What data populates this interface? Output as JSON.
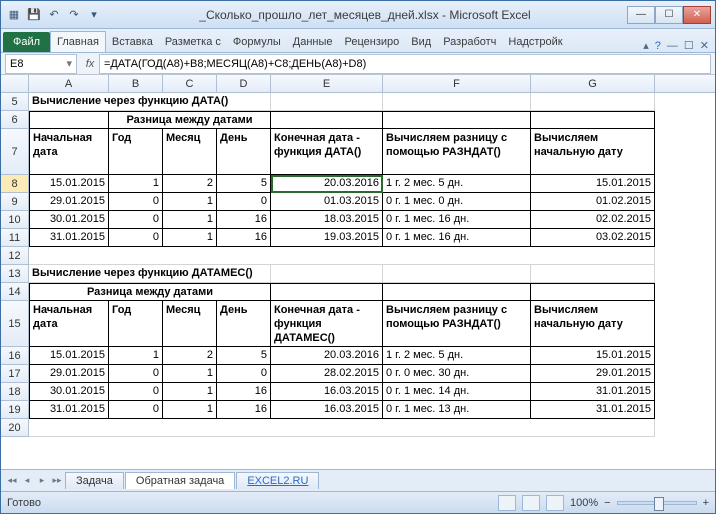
{
  "title": "_Сколько_прошло_лет_месяцев_дней.xlsx - Microsoft Excel",
  "ribbon": {
    "file": "Файл",
    "tabs": [
      "Главная",
      "Вставка",
      "Разметка с",
      "Формулы",
      "Данные",
      "Рецензиро",
      "Вид",
      "Разработч",
      "Надстройк"
    ]
  },
  "name_box": "E8",
  "formula": "=ДАТА(ГОД(A8)+B8;МЕСЯЦ(A8)+C8;ДЕНЬ(A8)+D8)",
  "cols": [
    "A",
    "B",
    "C",
    "D",
    "E",
    "F",
    "G"
  ],
  "row5_title": "Вычисление через функцию ДАТА()",
  "row6_merge": "Разница между датами",
  "row7": {
    "a": "Начальная дата",
    "b": "Год",
    "c": "Месяц",
    "d": "День",
    "e": "Конечная дата - функция ДАТА()",
    "f": "Вычисляем разницу с помощью РАЗНДАТ()",
    "g": "Вычисляем начальную дату"
  },
  "data1": [
    {
      "a": "15.01.2015",
      "b": "1",
      "c": "2",
      "d": "5",
      "e": "20.03.2016",
      "f": "1 г. 2 мес. 5 дн.",
      "g": "15.01.2015"
    },
    {
      "a": "29.01.2015",
      "b": "0",
      "c": "1",
      "d": "0",
      "e": "01.03.2015",
      "f": "0 г. 1 мес. 0 дн.",
      "g": "01.02.2015"
    },
    {
      "a": "30.01.2015",
      "b": "0",
      "c": "1",
      "d": "16",
      "e": "18.03.2015",
      "f": "0 г. 1 мес. 16 дн.",
      "g": "02.02.2015"
    },
    {
      "a": "31.01.2015",
      "b": "0",
      "c": "1",
      "d": "16",
      "e": "19.03.2015",
      "f": "0 г. 1 мес. 16 дн.",
      "g": "03.02.2015"
    }
  ],
  "row13_title": "Вычисление через функцию ДАТАМЕС()",
  "row14_merge": "Разница между датами",
  "row15": {
    "a": "Начальная дата",
    "b": "Год",
    "c": "Месяц",
    "d": "День",
    "e": "Конечная дата - функция ДАТАМЕС()",
    "f": "Вычисляем разницу с помощью РАЗНДАТ()",
    "g": "Вычисляем начальную дату"
  },
  "data2": [
    {
      "a": "15.01.2015",
      "b": "1",
      "c": "2",
      "d": "5",
      "e": "20.03.2016",
      "f": "1 г. 2 мес. 5 дн.",
      "g": "15.01.2015"
    },
    {
      "a": "29.01.2015",
      "b": "0",
      "c": "1",
      "d": "0",
      "e": "28.02.2015",
      "f": "0 г. 0 мес. 30 дн.",
      "g": "29.01.2015"
    },
    {
      "a": "30.01.2015",
      "b": "0",
      "c": "1",
      "d": "16",
      "e": "16.03.2015",
      "f": "0 г. 1 мес. 14 дн.",
      "g": "31.01.2015"
    },
    {
      "a": "31.01.2015",
      "b": "0",
      "c": "1",
      "d": "16",
      "e": "16.03.2015",
      "f": "0 г. 1 мес. 13 дн.",
      "g": "31.01.2015"
    }
  ],
  "sheet_tabs": {
    "t1": "Задача",
    "t2": "Обратная задача",
    "link": "EXCEL2.RU"
  },
  "status": "Готово",
  "zoom": "100%"
}
